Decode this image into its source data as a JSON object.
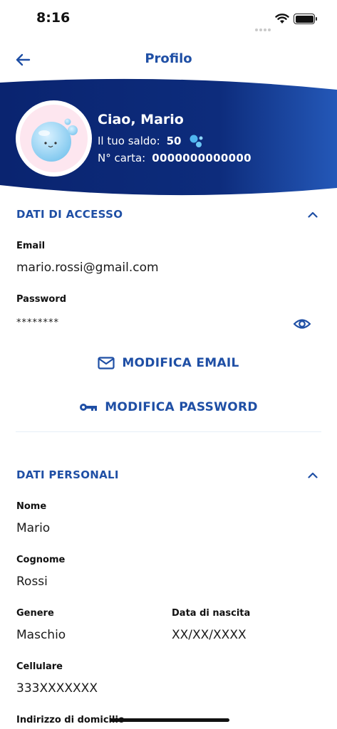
{
  "status_bar": {
    "time": "8:16"
  },
  "nav": {
    "title": "Profilo"
  },
  "header": {
    "greeting": "Ciao, Mario",
    "balance_label": "Il tuo saldo:",
    "balance_value": "50",
    "card_label": "N° carta:",
    "card_value": "0000000000000",
    "colors": {
      "dark_blue": "#0c2a78",
      "light_blue": "#1e4fb0"
    }
  },
  "access_section": {
    "title": "DATI DI ACCESSO",
    "email_label": "Email",
    "email_value": "mario.rossi@gmail.com",
    "password_label": "Password",
    "password_value": "********",
    "edit_email": "MODIFICA EMAIL",
    "edit_password": "MODIFICA PASSWORD"
  },
  "personal_section": {
    "title": "DATI PERSONALI",
    "name_label": "Nome",
    "name_value": "Mario",
    "surname_label": "Cognome",
    "surname_value": "Rossi",
    "gender_label": "Genere",
    "gender_value": "Maschio",
    "birthdate_label": "Data di nascita",
    "birthdate_value": "XX/XX/XXXX",
    "phone_label": "Cellulare",
    "phone_value": "333XXXXXXX",
    "address_label": "Indirizzo di domicilio"
  },
  "icons": [
    "wifi-icon",
    "battery-icon",
    "back-arrow-icon",
    "bubbles-icon",
    "chevron-up-icon",
    "eye-icon",
    "mail-icon",
    "key-icon"
  ],
  "accent_color": "#1f4fa5"
}
